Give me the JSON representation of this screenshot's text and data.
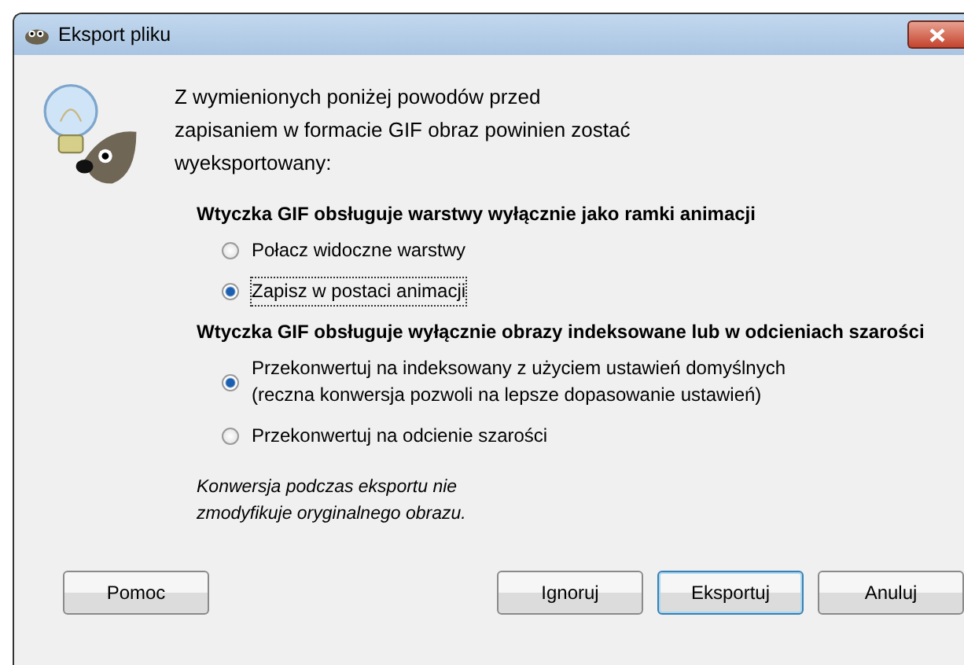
{
  "window": {
    "title": "Eksport pliku"
  },
  "intro": "Z wymienionych poniżej powodów przed zapisaniem w formacie GIF obraz powinien zostać wyeksportowany:",
  "sections": [
    {
      "heading": "Wtyczka GIF obsługuje warstwy wyłącznie jako ramki animacji",
      "options": [
        {
          "label": "Połacz widoczne warstwy",
          "selected": false
        },
        {
          "label": "Zapisz w postaci animacji",
          "selected": true
        }
      ]
    },
    {
      "heading": "Wtyczka GIF obsługuje wyłącznie obrazy indeksowane lub w odcieniach szarości",
      "options": [
        {
          "label": "Przekonwertuj na indeksowany z użyciem ustawień domyślnych",
          "note": "(reczna konwersja pozwoli na lepsze dopasowanie ustawień)",
          "selected": true
        },
        {
          "label": "Przekonwertuj na odcienie szarości",
          "selected": false
        }
      ]
    }
  ],
  "footnote": "Konwersja podczas eksportu nie zmodyfikuje oryginalnego obrazu.",
  "buttons": {
    "left": [
      "Pomoc"
    ],
    "right": [
      {
        "label": "Ignoruj",
        "default": false
      },
      {
        "label": "Eksportuj",
        "default": true
      },
      {
        "label": "Anuluj",
        "default": false
      }
    ]
  }
}
